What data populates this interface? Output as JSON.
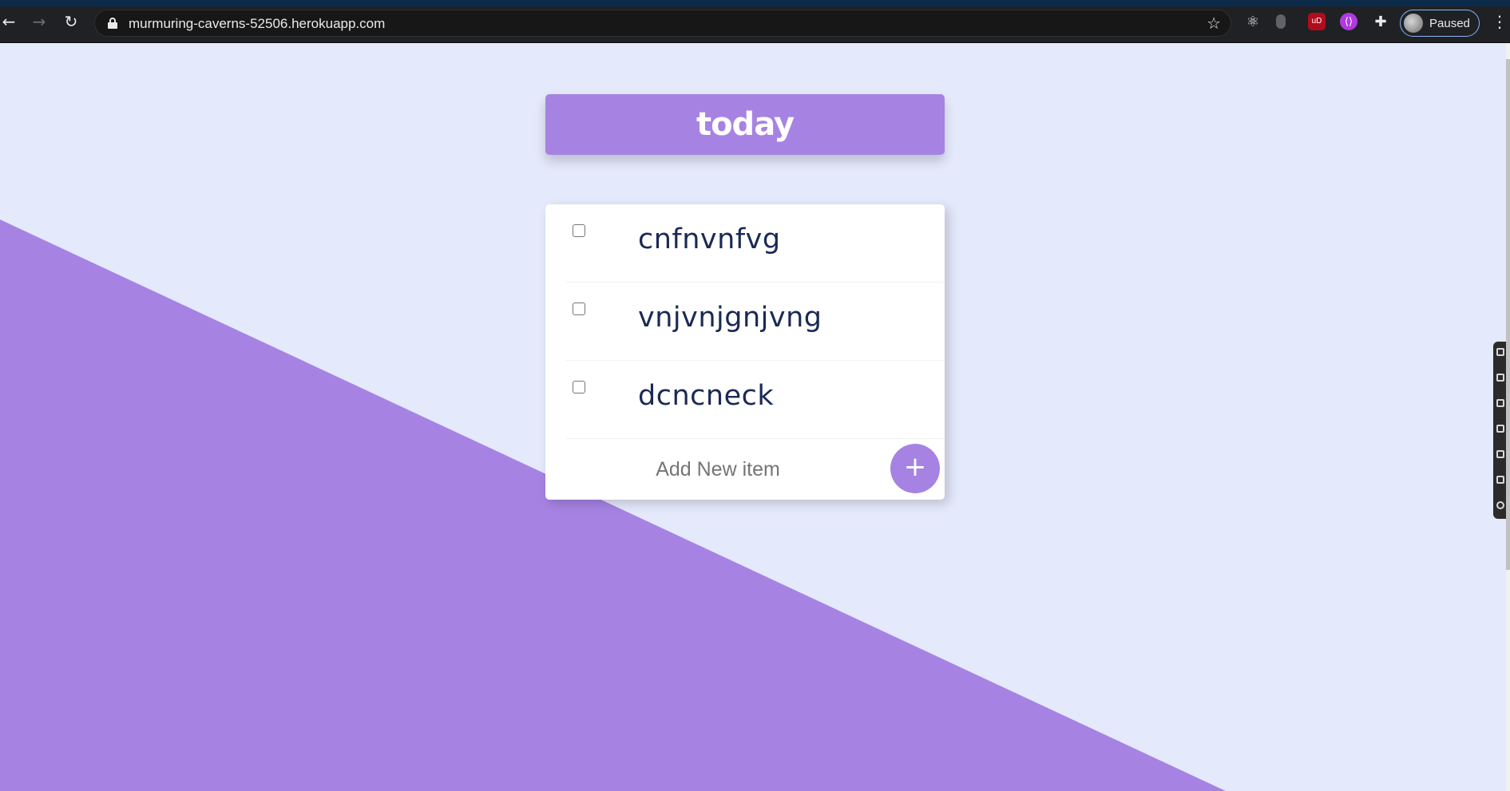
{
  "browser": {
    "url": "murmuring-caverns-52506.herokuapp.com",
    "profile_label": "Paused",
    "back_icon": "arrow-left-icon",
    "forward_icon": "arrow-right-icon",
    "reload_icon": "reload-icon",
    "extensions": [
      "react-devtools-icon",
      "extension-icon",
      "ublock-icon",
      "extension-purple-icon",
      "puzzle-icon"
    ]
  },
  "app": {
    "title": "today",
    "items": [
      {
        "label": "cnfnvnfvg",
        "checked": false
      },
      {
        "label": "vnjvnjgnjvng",
        "checked": false
      },
      {
        "label": "dcncneck",
        "checked": false
      }
    ],
    "add_placeholder": "Add New item",
    "add_button_label": "+"
  },
  "colors": {
    "background": "#E4E9FB",
    "accent": "#A683E3",
    "item_text": "#1a2a55"
  }
}
